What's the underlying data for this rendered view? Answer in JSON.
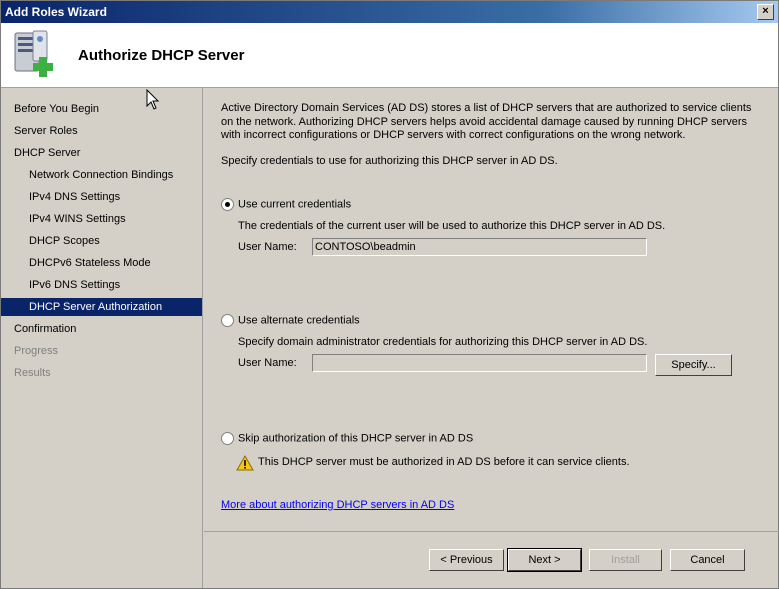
{
  "window": {
    "title": "Add Roles Wizard",
    "close_glyph": "×"
  },
  "header": {
    "title": "Authorize DHCP Server",
    "icon": "server-add-icon"
  },
  "sidebar": {
    "items": [
      {
        "label": "Before You Begin",
        "level": 1,
        "state": "normal"
      },
      {
        "label": "Server Roles",
        "level": 1,
        "state": "normal"
      },
      {
        "label": "DHCP Server",
        "level": 1,
        "state": "normal"
      },
      {
        "label": "Network Connection Bindings",
        "level": 2,
        "state": "normal"
      },
      {
        "label": "IPv4 DNS Settings",
        "level": 2,
        "state": "normal"
      },
      {
        "label": "IPv4 WINS Settings",
        "level": 2,
        "state": "normal"
      },
      {
        "label": "DHCP Scopes",
        "level": 2,
        "state": "normal"
      },
      {
        "label": "DHCPv6 Stateless Mode",
        "level": 2,
        "state": "normal"
      },
      {
        "label": "IPv6 DNS Settings",
        "level": 2,
        "state": "normal"
      },
      {
        "label": "DHCP Server Authorization",
        "level": 2,
        "state": "active"
      },
      {
        "label": "Confirmation",
        "level": 1,
        "state": "normal"
      },
      {
        "label": "Progress",
        "level": 1,
        "state": "disabled"
      },
      {
        "label": "Results",
        "level": 1,
        "state": "disabled"
      }
    ]
  },
  "content": {
    "description": "Active Directory Domain Services (AD DS) stores a list of DHCP servers that are authorized to service clients on the network. Authorizing DHCP servers helps avoid accidental damage caused by running DHCP servers with incorrect configurations or DHCP servers with correct configurations on the wrong network.",
    "instruction": "Specify credentials to use for authorizing this DHCP server in AD DS.",
    "option_current": {
      "label": "Use current credentials",
      "checked": true,
      "help": "The credentials of the current user will be used to authorize this DHCP server in AD DS.",
      "user_label": "User Name:",
      "user_value": "CONTOSO\\beadmin"
    },
    "option_alternate": {
      "label": "Use alternate credentials",
      "checked": false,
      "help": "Specify domain administrator credentials for authorizing this DHCP server in AD DS.",
      "user_label": "User Name:",
      "user_value": "",
      "specify_button": "Specify..."
    },
    "option_skip": {
      "label": "Skip authorization of this DHCP server in AD DS",
      "checked": false,
      "warning": "This DHCP server must be authorized in AD DS before it can service clients."
    },
    "help_link": "More about authorizing DHCP servers in AD DS"
  },
  "buttons": {
    "previous": "< Previous",
    "next": "Next >",
    "install": "Install",
    "cancel": "Cancel"
  }
}
